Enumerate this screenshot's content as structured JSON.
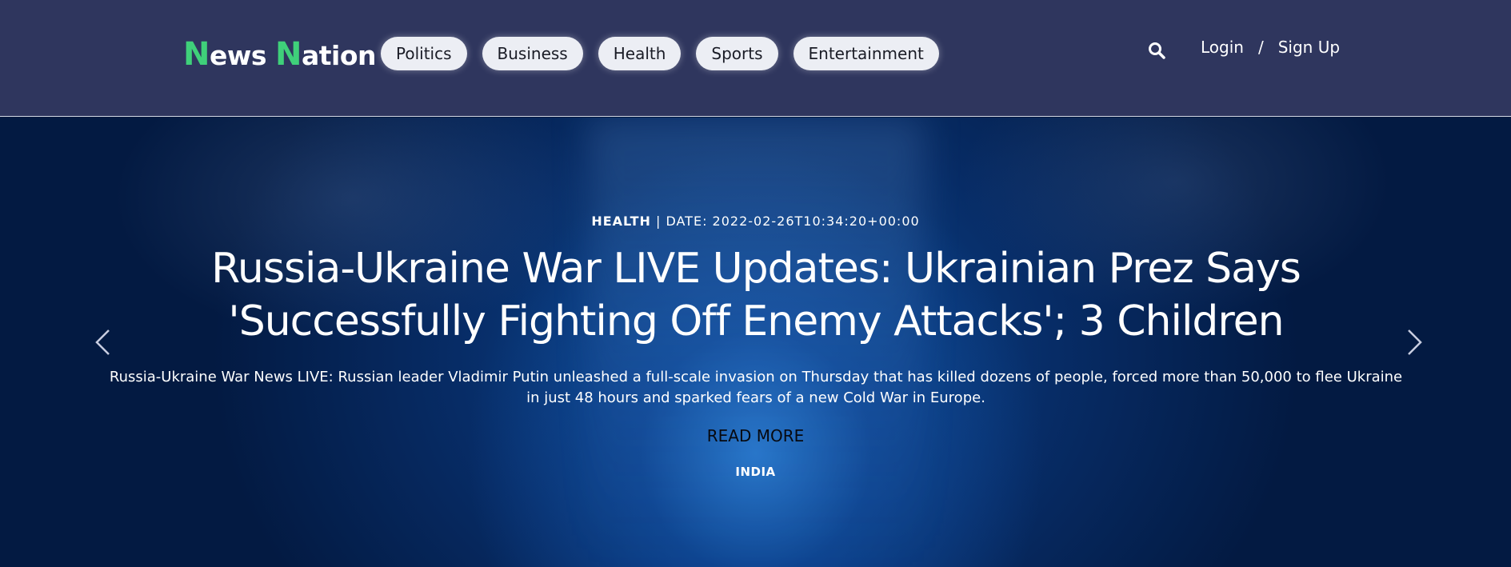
{
  "brand": {
    "first_cap": "N",
    "first_rest": "ews ",
    "second_cap": "N",
    "second_rest": "ation",
    "accent_color": "#3fd07a"
  },
  "nav": {
    "items": [
      {
        "label": "Politics"
      },
      {
        "label": "Business"
      },
      {
        "label": "Health"
      },
      {
        "label": "Sports"
      },
      {
        "label": "Entertainment"
      }
    ]
  },
  "header": {
    "search_icon": "search-icon",
    "login_label": "Login",
    "separator": "/",
    "signup_label": "Sign Up",
    "background_color": "#2f365e"
  },
  "hero": {
    "category": "HEALTH",
    "meta_separator": " | ",
    "date_text": "DATE: 2022-02-26T10:34:20+00:00",
    "headline": "Russia-Ukraine War LIVE Updates: Ukrainian Prez Says 'Successfully Fighting Off Enemy Attacks'; 3 Children",
    "summary": "Russia-Ukraine War News LIVE: Russian leader Vladimir Putin unleashed a full-scale invasion on Thursday that has killed dozens of people, forced more than 50,000 to flee Ukraine in just 48 hours and sparked fears of a new Cold War in Europe.",
    "read_more": "READ MORE",
    "tag": "INDIA",
    "prev_icon": "chevron-left-icon",
    "next_icon": "chevron-right-icon"
  }
}
